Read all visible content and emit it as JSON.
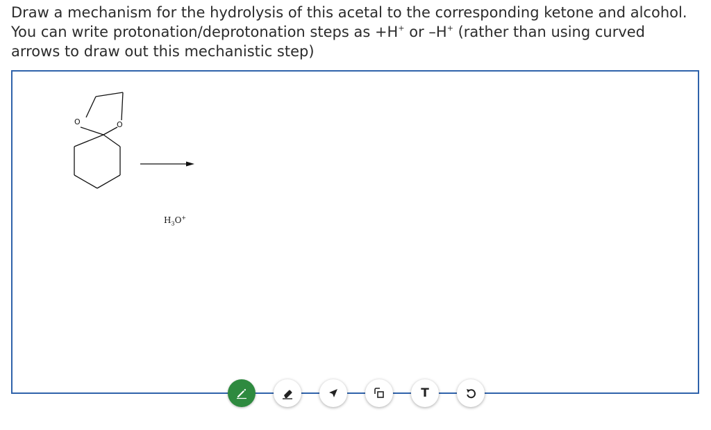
{
  "question": {
    "part1": "Draw a mechanism for the hydrolysis of this acetal to the corresponding ketone and alcohol. You can write protonation/deprotonation steps as +H",
    "sup1": "+",
    "part2": " or –H",
    "sup2": "+",
    "part3": " (rather than using curved arrows to draw out this mechanistic step)"
  },
  "molecule": {
    "atom_o1": "O",
    "atom_o2": "O"
  },
  "reagent": {
    "h": "H",
    "sub": "3",
    "o": "O",
    "sup": "+"
  },
  "toolbar": {
    "tools": [
      {
        "name": "pen",
        "icon": "pencil-icon",
        "active": true
      },
      {
        "name": "eraser",
        "icon": "eraser-icon",
        "active": false
      },
      {
        "name": "select",
        "icon": "arrow-pointer-icon",
        "active": false
      },
      {
        "name": "shapes",
        "icon": "shapes-icon",
        "active": false
      },
      {
        "name": "text",
        "icon": "text-icon",
        "label": "T",
        "active": false
      },
      {
        "name": "undo",
        "icon": "undo-icon",
        "active": false
      }
    ]
  },
  "colors": {
    "canvas_border": "#2f62aa",
    "active_tool": "#2e8a3f"
  }
}
